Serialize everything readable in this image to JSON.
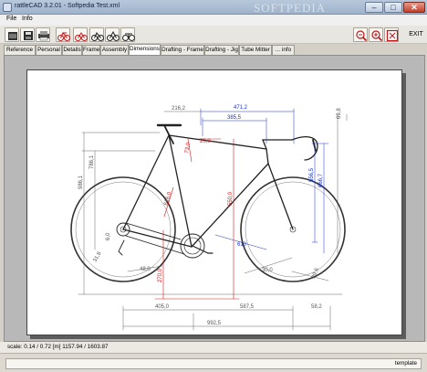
{
  "window": {
    "title": "rattleCAD   3.2.01  - Softpedia Test.xml",
    "watermark": "SOFTPEDIA",
    "minimize_glyph": "–",
    "maximize_glyph": "□",
    "close_glyph": "✕"
  },
  "menu": {
    "file": "File",
    "info": "Info"
  },
  "toolbar": {
    "left_icons": [
      "open-file-icon",
      "save-icon",
      "print-icon",
      "bike-red-icon",
      "bike-red-icon",
      "bike-black-icon",
      "bike-black-icon",
      "bike-black-icon"
    ],
    "right_icons": [
      "zoom-out-icon",
      "zoom-in-icon",
      "fit-page-icon"
    ],
    "exit_label": "EXIT"
  },
  "tabs": [
    "Reference",
    "Personal",
    "Details",
    "Frame",
    "Assembly",
    "Dimensions",
    "Drafting - Frame",
    "Drafting - Jig",
    "Tube Mitter",
    "... info"
  ],
  "active_tab": "Dimensions",
  "drawing": {
    "dimensions": {
      "d_216_2": "216,2",
      "d_471_2": "471,2",
      "d_385_5": "385,5",
      "d_69_8": "69,8",
      "d_20_0": "20,0",
      "d_556_5": "556,5",
      "d_666_7": "666,7",
      "d_786_1": "786,1",
      "d_986_1": "986,1",
      "d_550_0": "550,0",
      "d_73_0": "73,0",
      "d_616_0": "616,0",
      "d_610": "610",
      "d_270_0": "270,0",
      "d_48_0": "48,0",
      "d_587_5": "587,5",
      "d_405_0": "405,0",
      "d_58_2": "58,2",
      "d_992_5": "992,5",
      "d_6_0": "6,0",
      "d_31_8": "31,8",
      "d_30_0": "30,0",
      "d_39_6": "39,6"
    },
    "colors": {
      "blue": "#1a35c8",
      "red": "#d01818",
      "black": "#111111",
      "gray": "#555555"
    }
  },
  "status": {
    "text": "scale: 0.14 / 0.72  [m]  1157.94 / 1603.87"
  },
  "bottom": {
    "template": "template"
  }
}
